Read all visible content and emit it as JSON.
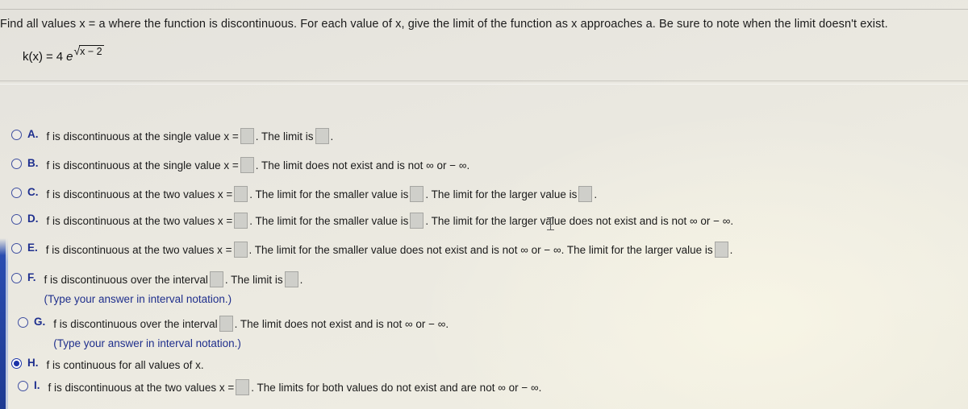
{
  "prompt": "Find all values x = a where the function is discontinuous. For each value of x, give the limit of the function as x approaches a. Be sure to note when the limit doesn't exist.",
  "function": {
    "name": "k(x)",
    "equals": "=",
    "coefficient": "4",
    "base": "e",
    "radical_sign": "√",
    "exponent_radicand": "x − 2",
    "full_text": "k(x) = 4 e ^ √(x-2)"
  },
  "options": [
    {
      "letter": "A.",
      "selected": false,
      "segments": [
        "f is discontinuous at the single value x =",
        "blank",
        ". The limit is",
        "blank",
        "."
      ],
      "note": null
    },
    {
      "letter": "B.",
      "selected": false,
      "segments": [
        "f is discontinuous at the single value x =",
        "blank",
        ". The limit does not exist and is not ∞ or − ∞."
      ],
      "note": null
    },
    {
      "letter": "C.",
      "selected": false,
      "segments": [
        "f is discontinuous at the two values x =",
        "blank",
        ". The limit for the smaller value is",
        "blank",
        ". The limit for the larger value is",
        "blank",
        "."
      ],
      "note": null
    },
    {
      "letter": "D.",
      "selected": false,
      "segments": [
        "f is discontinuous at the two values x =",
        "blank",
        ". The limit for the smaller value is",
        "blank",
        ". The limit for the larger value does not exist and is not ∞ or − ∞."
      ],
      "note": null
    },
    {
      "letter": "E.",
      "selected": false,
      "segments": [
        "f is discontinuous at the two values x =",
        "blank",
        ". The limit for the smaller value does not exist and is not ∞ or − ∞. The limit for the larger value is",
        "blank",
        "."
      ],
      "note": null
    },
    {
      "letter": "F.",
      "selected": false,
      "segments": [
        "f is discontinuous over the interval",
        "blank",
        ". The limit is",
        "blank",
        "."
      ],
      "note": "(Type your answer in interval notation.)"
    },
    {
      "letter": "G.",
      "selected": false,
      "segments": [
        "f is discontinuous over the interval",
        "blank",
        ". The limit does not exist and is not ∞ or − ∞."
      ],
      "note": "(Type your answer in interval notation.)"
    },
    {
      "letter": "H.",
      "selected": true,
      "segments": [
        "f is continuous for all values of x."
      ],
      "note": null
    },
    {
      "letter": "I.",
      "selected": false,
      "segments": [
        "f is discontinuous at the two values x =",
        "blank",
        ". The limits for both values do not exist and are not ∞ or − ∞."
      ],
      "note": null
    }
  ],
  "colors": {
    "option_letter": "#1e2f8e",
    "radio_selected": "#1b33a8",
    "blank_field": "#cfcfca",
    "rail": "#2a4cb0",
    "page_background": "#eceae1",
    "text": "#1b1b1b"
  }
}
